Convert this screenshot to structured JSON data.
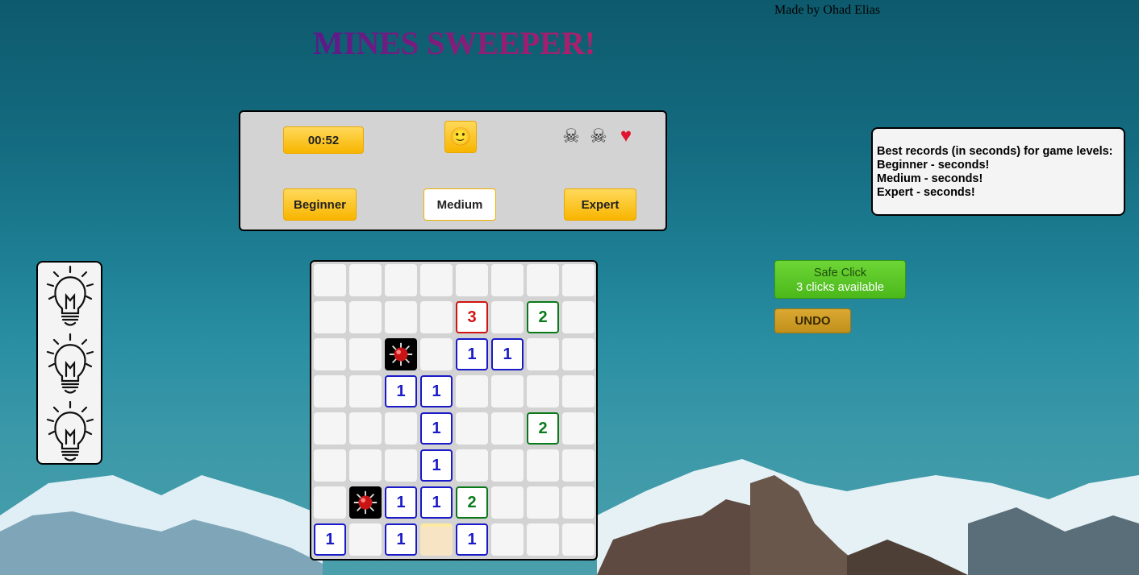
{
  "credit": "Made by Ohad Elias",
  "title": "MINES SWEEPER!",
  "panel": {
    "timer": "00:52",
    "smiley": "🙂",
    "smiley_icon": "smiley-face-icon",
    "levels": [
      "Beginner",
      "Medium",
      "Expert"
    ],
    "selected_level": "Medium",
    "lives": [
      "skull-icon",
      "skull-icon",
      "heart-icon"
    ]
  },
  "records": {
    "heading": "Best records (in seconds) for game levels:",
    "beginner": "Beginner - seconds!",
    "medium": "Medium - seconds!",
    "expert": "Expert - seconds!"
  },
  "hints": {
    "count": 3,
    "icon": "lightbulb-icon"
  },
  "safe_click": {
    "label": "Safe Click",
    "status": "3 clicks available"
  },
  "undo_label": "UNDO",
  "board": {
    "rows": [
      [
        "",
        "",
        "",
        "",
        "",
        "",
        "",
        ""
      ],
      [
        "",
        "",
        "",
        "",
        "3",
        "",
        "2",
        ""
      ],
      [
        "",
        "",
        "*",
        "",
        "1",
        "1",
        "",
        ""
      ],
      [
        "",
        "",
        "1",
        "1",
        "",
        "",
        "",
        ""
      ],
      [
        "",
        "",
        "",
        "1",
        "",
        "",
        "2",
        ""
      ],
      [
        "",
        "",
        "",
        "1",
        "",
        "",
        "",
        ""
      ],
      [
        "",
        "*",
        "1",
        "1",
        "2",
        "",
        "",
        ""
      ],
      [
        "1",
        "",
        "1",
        "h",
        "1",
        "",
        "",
        ""
      ]
    ]
  }
}
